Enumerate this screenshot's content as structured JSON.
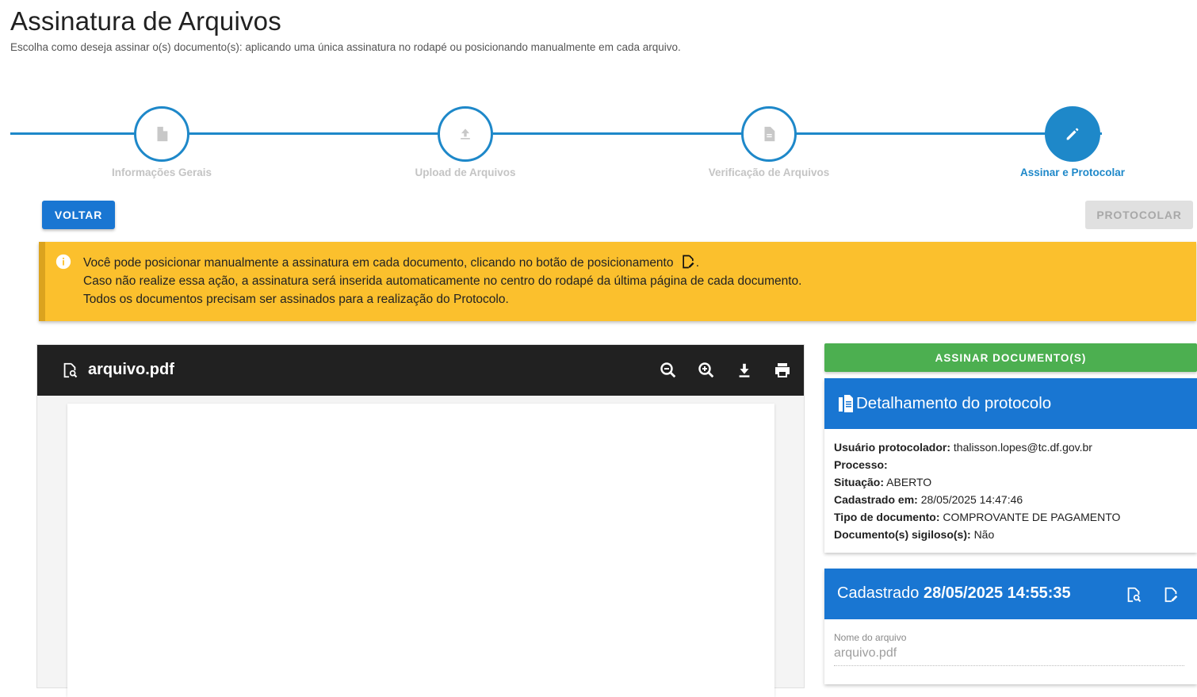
{
  "page": {
    "title": "Assinatura de Arquivos",
    "subtitle": "Escolha como deseja assinar o(s) documento(s): aplicando uma única assinatura no rodapé ou posicionando manualmente em cada arquivo."
  },
  "stepper": {
    "steps": [
      {
        "label": "Informações Gerais",
        "icon": "file-icon"
      },
      {
        "label": "Upload de Arquivos",
        "icon": "upload-icon"
      },
      {
        "label": "Verificação de Arquivos",
        "icon": "document-icon"
      },
      {
        "label": "Assinar e Protocolar",
        "icon": "pencil-icon"
      }
    ],
    "active_index": 3
  },
  "actions": {
    "back_label": "VOLTAR",
    "submit_label": "PROTOCOLAR"
  },
  "alert": {
    "line1": "Você pode posicionar manualmente a assinatura em cada documento, clicando no botão de posicionamento",
    "line1_end": ".",
    "line2": "Caso não realize essa ação, a assinatura será inserida automaticamente no centro do rodapé da última página de cada documento.",
    "line3": "Todos os documentos precisam ser assinados para a realização do Protocolo."
  },
  "viewer": {
    "file_name": "arquivo.pdf",
    "tools": [
      "zoom-out-icon",
      "zoom-in-icon",
      "download-icon",
      "print-icon"
    ]
  },
  "sign_button": "ASSINAR DOCUMENTO(S)",
  "protocol": {
    "title": "Detalhamento do protocolo",
    "fields": [
      {
        "label": "Usuário protocolador:",
        "value": "thalisson.lopes@tc.df.gov.br"
      },
      {
        "label": "Processo:",
        "value": ""
      },
      {
        "label": "Situação:",
        "value": "ABERTO"
      },
      {
        "label": "Cadastrado em:",
        "value": "28/05/2025 14:47:46"
      },
      {
        "label": "Tipo de documento:",
        "value": "COMPROVANTE DE PAGAMENTO"
      },
      {
        "label": "Documento(s) sigiloso(s):",
        "value": "Não"
      }
    ]
  },
  "file_card": {
    "prefix": "Cadastrado",
    "datetime": "28/05/2025 14:55:35",
    "field_label": "Nome do arquivo",
    "field_value": "arquivo.pdf"
  },
  "colors": {
    "primary": "#1976d2",
    "stepper": "#1e88c9",
    "warning": "#fbc02d",
    "success": "#4caf50",
    "viewer_bar": "#212121"
  }
}
